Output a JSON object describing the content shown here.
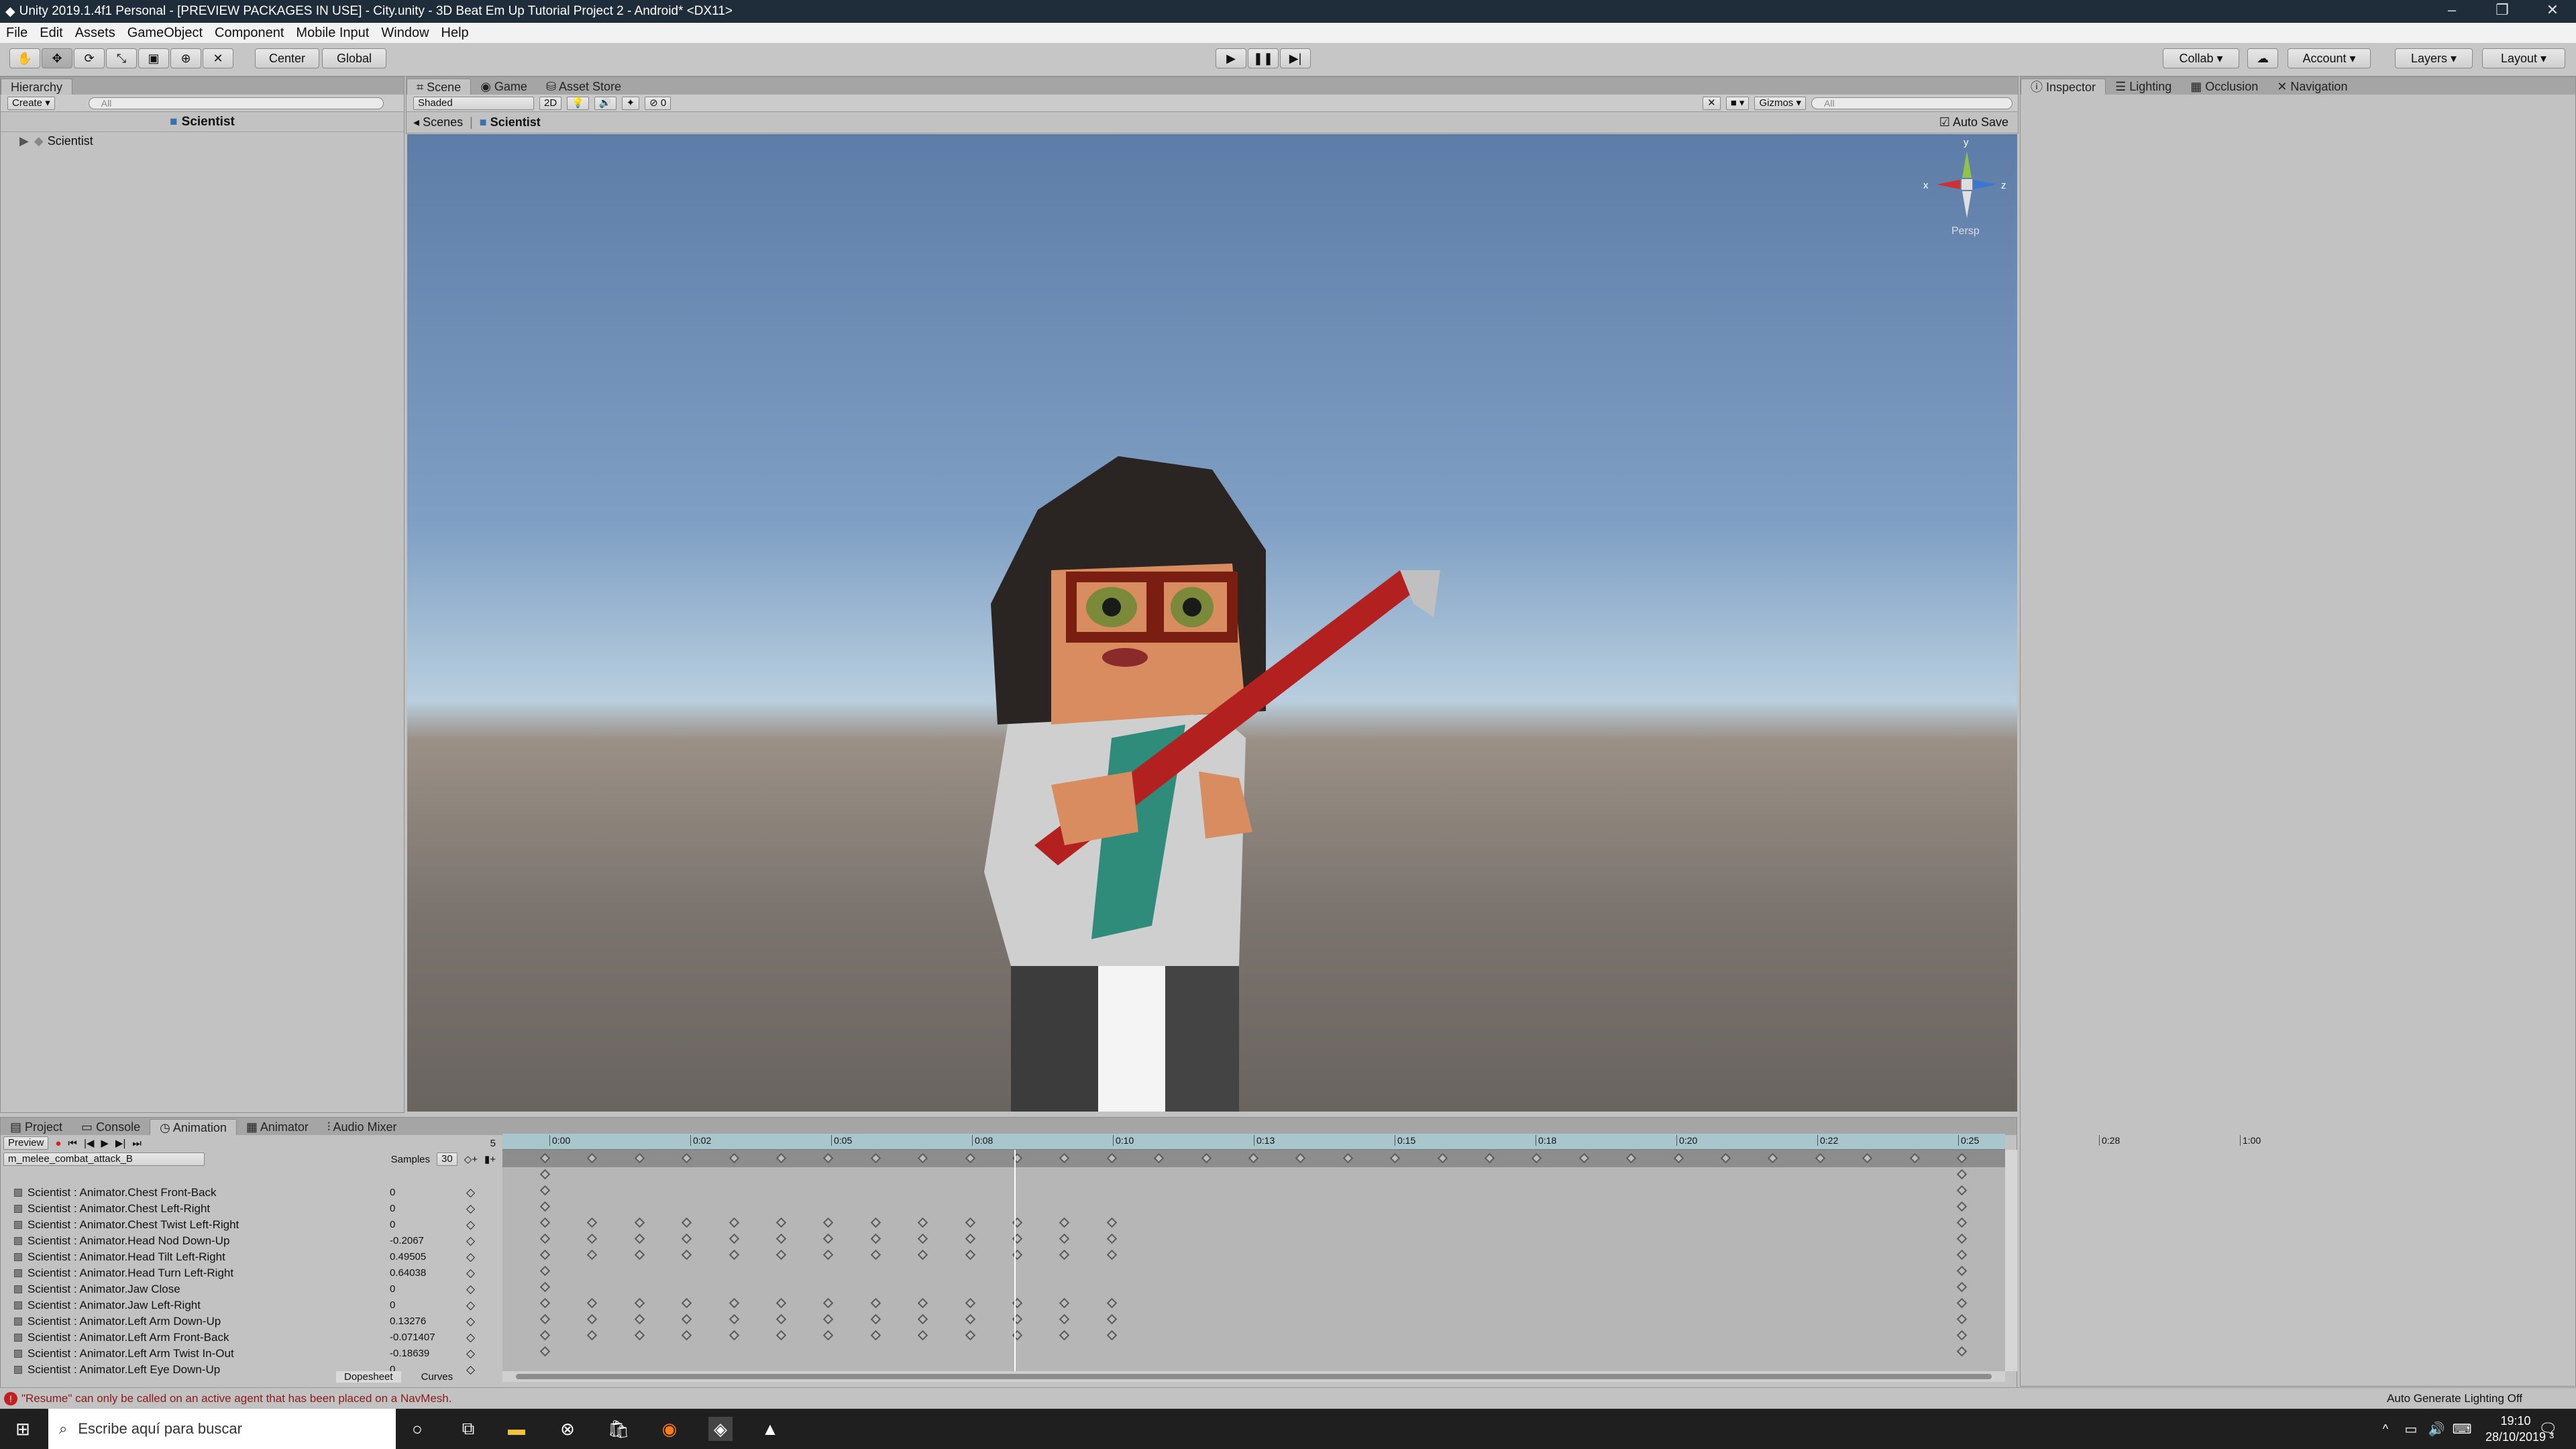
{
  "window": {
    "title": "Unity 2019.1.4f1 Personal - [PREVIEW PACKAGES IN USE] - City.unity - 3D Beat Em Up Tutorial Project 2 - Android* <DX11>"
  },
  "menu": [
    "File",
    "Edit",
    "Assets",
    "GameObject",
    "Component",
    "Mobile Input",
    "Window",
    "Help"
  ],
  "toolbar": {
    "center": "Center",
    "global": "Global",
    "collab": "Collab",
    "account": "Account",
    "layers": "Layers",
    "layout": "Layout"
  },
  "hierarchy": {
    "tab": "Hierarchy",
    "create": "Create",
    "search": "All",
    "scene": "Scientist",
    "item": "Scientist"
  },
  "scene": {
    "tabs": [
      "Scene",
      "Game",
      "Asset Store"
    ],
    "shading": "Shaded",
    "mode2d": "2D",
    "count": "0",
    "gizmos": "Gizmos",
    "search": "All",
    "crumb1": "Scenes",
    "crumb2": "Scientist",
    "autosave": "Auto Save",
    "persp": "Persp",
    "axis_x": "x",
    "axis_y": "y",
    "axis_z": "z"
  },
  "inspector": {
    "tabs": [
      "Inspector",
      "Lighting",
      "Occlusion",
      "Navigation"
    ]
  },
  "bottom_tabs": [
    "Project",
    "Console",
    "Animation",
    "Animator",
    "Audio Mixer"
  ],
  "animation": {
    "preview": "Preview",
    "clip": "m_melee_combat_attack_B",
    "samples_label": "Samples",
    "samples": "30",
    "frame": "5",
    "ticks": [
      "0:00",
      "0:02",
      "0:05",
      "0:08",
      "0:10",
      "0:13",
      "0:15",
      "0:18",
      "0:20",
      "0:22",
      "0:25",
      "0:28",
      "1:00"
    ],
    "properties": [
      {
        "name": "Scientist : Animator.Chest Front-Back",
        "value": "0"
      },
      {
        "name": "Scientist : Animator.Chest Left-Right",
        "value": "0"
      },
      {
        "name": "Scientist : Animator.Chest Twist Left-Right",
        "value": "0"
      },
      {
        "name": "Scientist : Animator.Head Nod Down-Up",
        "value": "-0.2067"
      },
      {
        "name": "Scientist : Animator.Head Tilt Left-Right",
        "value": "0.49505"
      },
      {
        "name": "Scientist : Animator.Head Turn Left-Right",
        "value": "0.64038"
      },
      {
        "name": "Scientist : Animator.Jaw Close",
        "value": "0"
      },
      {
        "name": "Scientist : Animator.Jaw Left-Right",
        "value": "0"
      },
      {
        "name": "Scientist : Animator.Left Arm Down-Up",
        "value": "0.13276"
      },
      {
        "name": "Scientist : Animator.Left Arm Front-Back",
        "value": "-0.071407"
      },
      {
        "name": "Scientist : Animator.Left Arm Twist In-Out",
        "value": "-0.18639"
      },
      {
        "name": "Scientist : Animator.Left Eye Down-Up",
        "value": "0"
      }
    ],
    "dopesheet": "Dopesheet",
    "curves": "Curves"
  },
  "status": {
    "error": "\"Resume\" can only be called on an active agent that has been placed on a NavMesh.",
    "lighting": "Auto Generate Lighting Off"
  },
  "taskbar": {
    "search": "Escribe aquí para buscar",
    "time": "19:10",
    "date": "28/10/2019",
    "notif": "3"
  }
}
